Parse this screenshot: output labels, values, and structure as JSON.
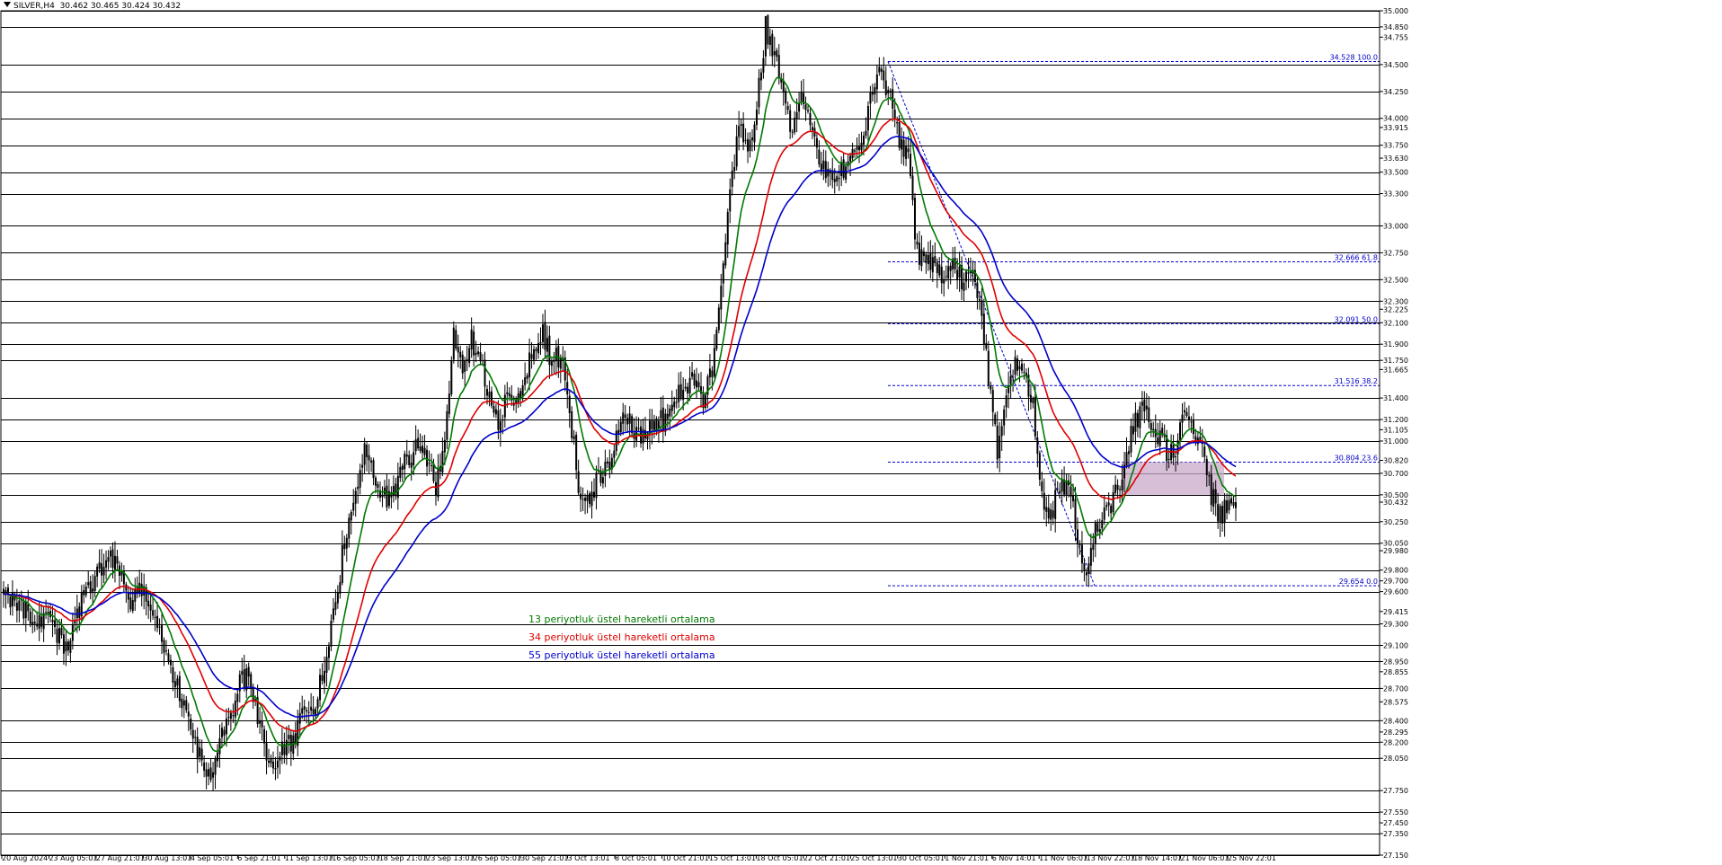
{
  "header": {
    "symbol": "SILVER,H4",
    "ohlc": "30.462 30.465 30.424 30.432"
  },
  "colors": {
    "ema13": "#007a00",
    "ema34": "#e00000",
    "ema55": "#0000cc",
    "fib": "#0000cc",
    "zone": "#c9aac9",
    "candle": "#000000"
  },
  "legend": [
    {
      "label": "13 periyotluk üstel hareketli ortalama",
      "color": "#007a00"
    },
    {
      "label": "34 periyotluk üstel hareketli ortalama",
      "color": "#e00000"
    },
    {
      "label": "55 periyotluk üstel hareketli ortalama",
      "color": "#0000cc"
    }
  ],
  "chart_data": {
    "type": "candlestick",
    "symbol": "SILVER",
    "timeframe": "H4",
    "y_range": [
      27.15,
      35.0
    ],
    "x_ticks": [
      "20 Aug 2024",
      "23 Aug 05:01",
      "27 Aug 21:01",
      "30 Aug 13:01",
      "4 Sep 05:01",
      "6 Sep 21:01",
      "11 Sep 13:01",
      "16 Sep 05:01",
      "18 Sep 21:01",
      "23 Sep 13:01",
      "26 Sep 05:01",
      "30 Sep 21:01",
      "3 Oct 13:01",
      "8 Oct 05:01",
      "10 Oct 21:01",
      "15 Oct 13:01",
      "18 Oct 05:01",
      "22 Oct 21:01",
      "25 Oct 13:01",
      "30 Oct 05:01",
      "1 Nov 21:01",
      "6 Nov 14:01",
      "11 Nov 06:01",
      "13 Nov 22:01",
      "18 Nov 14:01",
      "21 Nov 06:01",
      "25 Nov 22:01"
    ],
    "y_ticks": [
      "35.000",
      "34.850",
      "34.755",
      "34.500",
      "34.250",
      "34.000",
      "33.915",
      "33.750",
      "33.630",
      "33.500",
      "33.300",
      "33.000",
      "32.750",
      "32.500",
      "32.300",
      "32.225",
      "32.100",
      "31.900",
      "31.750",
      "31.665",
      "31.400",
      "31.200",
      "31.105",
      "31.000",
      "30.820",
      "30.700",
      "30.500",
      "30.432",
      "30.250",
      "30.050",
      "29.980",
      "29.800",
      "29.700",
      "29.600",
      "29.415",
      "29.300",
      "29.100",
      "28.950",
      "28.855",
      "28.700",
      "28.575",
      "28.400",
      "28.295",
      "28.200",
      "28.050",
      "27.750",
      "27.550",
      "27.450",
      "27.350",
      "27.150"
    ],
    "horizontal_levels": [
      35.0,
      34.85,
      34.5,
      34.25,
      34.0,
      33.75,
      33.5,
      33.3,
      33.0,
      32.75,
      32.5,
      32.3,
      32.1,
      31.9,
      31.75,
      31.4,
      31.2,
      31.0,
      30.7,
      30.5,
      30.25,
      30.05,
      29.8,
      29.6,
      29.3,
      29.1,
      28.95,
      28.7,
      28.4,
      28.2,
      28.05,
      27.75,
      27.55,
      27.35,
      27.15
    ],
    "current_price": 30.432,
    "fibonacci": {
      "high": 34.528,
      "low": 29.654,
      "levels": [
        {
          "price": 34.528,
          "label": "34.528 100.0"
        },
        {
          "price": 32.666,
          "label": "32.666 61.8"
        },
        {
          "price": 32.091,
          "label": "32.091 50.0"
        },
        {
          "price": 31.516,
          "label": "31.516 38.2"
        },
        {
          "price": 30.804,
          "label": "30.804 23.6"
        },
        {
          "price": 29.654,
          "label": "29.654 0.0"
        }
      ]
    },
    "zone": {
      "top": 30.804,
      "bottom": 30.5
    },
    "anchors": [
      [
        0,
        29.55
      ],
      [
        10,
        29.4
      ],
      [
        20,
        29.35
      ],
      [
        28,
        29.05
      ],
      [
        36,
        29.55
      ],
      [
        44,
        29.85
      ],
      [
        50,
        29.9
      ],
      [
        56,
        29.5
      ],
      [
        62,
        29.6
      ],
      [
        68,
        29.4
      ],
      [
        74,
        28.95
      ],
      [
        80,
        28.6
      ],
      [
        86,
        28.2
      ],
      [
        92,
        27.9
      ],
      [
        96,
        28.1
      ],
      [
        100,
        28.35
      ],
      [
        106,
        28.75
      ],
      [
        110,
        28.85
      ],
      [
        114,
        28.45
      ],
      [
        118,
        28.1
      ],
      [
        122,
        27.95
      ],
      [
        126,
        28.15
      ],
      [
        130,
        28.2
      ],
      [
        134,
        28.45
      ],
      [
        140,
        28.55
      ],
      [
        146,
        29.15
      ],
      [
        150,
        29.65
      ],
      [
        154,
        30.2
      ],
      [
        158,
        30.6
      ],
      [
        162,
        30.9
      ],
      [
        166,
        30.75
      ],
      [
        170,
        30.5
      ],
      [
        174,
        30.45
      ],
      [
        180,
        30.85
      ],
      [
        186,
        30.95
      ],
      [
        190,
        30.8
      ],
      [
        194,
        30.6
      ],
      [
        198,
        31.0
      ],
      [
        202,
        32.0
      ],
      [
        206,
        31.7
      ],
      [
        210,
        31.95
      ],
      [
        214,
        31.75
      ],
      [
        218,
        31.45
      ],
      [
        222,
        31.2
      ],
      [
        226,
        31.4
      ],
      [
        230,
        31.4
      ],
      [
        234,
        31.6
      ],
      [
        238,
        31.85
      ],
      [
        242,
        32.0
      ],
      [
        246,
        31.75
      ],
      [
        250,
        31.8
      ],
      [
        254,
        31.3
      ],
      [
        258,
        30.6
      ],
      [
        262,
        30.45
      ],
      [
        266,
        30.6
      ],
      [
        270,
        30.7
      ],
      [
        274,
        30.95
      ],
      [
        278,
        31.2
      ],
      [
        282,
        31.15
      ],
      [
        286,
        31.0
      ],
      [
        290,
        31.1
      ],
      [
        294,
        31.2
      ],
      [
        298,
        31.15
      ],
      [
        302,
        31.4
      ],
      [
        306,
        31.5
      ],
      [
        310,
        31.6
      ],
      [
        314,
        31.4
      ],
      [
        318,
        31.7
      ],
      [
        322,
        32.45
      ],
      [
        326,
        33.35
      ],
      [
        330,
        33.95
      ],
      [
        334,
        33.65
      ],
      [
        338,
        34.1
      ],
      [
        342,
        34.85
      ],
      [
        346,
        34.6
      ],
      [
        350,
        34.3
      ],
      [
        354,
        33.8
      ],
      [
        358,
        34.25
      ],
      [
        362,
        33.9
      ],
      [
        366,
        33.55
      ],
      [
        370,
        33.5
      ],
      [
        374,
        33.4
      ],
      [
        378,
        33.6
      ],
      [
        382,
        33.7
      ],
      [
        386,
        33.8
      ],
      [
        390,
        34.3
      ],
      [
        394,
        34.45
      ],
      [
        398,
        34.15
      ],
      [
        402,
        33.75
      ],
      [
        406,
        33.6
      ],
      [
        410,
        32.75
      ],
      [
        414,
        32.6
      ],
      [
        418,
        32.7
      ],
      [
        422,
        32.4
      ],
      [
        426,
        32.65
      ],
      [
        430,
        32.5
      ],
      [
        434,
        32.55
      ],
      [
        438,
        32.3
      ],
      [
        442,
        31.6
      ],
      [
        446,
        30.9
      ],
      [
        450,
        31.4
      ],
      [
        454,
        31.8
      ],
      [
        458,
        31.6
      ],
      [
        462,
        31.35
      ],
      [
        466,
        30.5
      ],
      [
        470,
        30.3
      ],
      [
        474,
        30.6
      ],
      [
        478,
        30.6
      ],
      [
        482,
        30.1
      ],
      [
        486,
        29.7
      ],
      [
        490,
        30.2
      ],
      [
        494,
        30.3
      ],
      [
        498,
        30.45
      ],
      [
        502,
        30.6
      ],
      [
        506,
        31.05
      ],
      [
        510,
        31.3
      ],
      [
        514,
        31.2
      ],
      [
        518,
        31.05
      ],
      [
        522,
        30.9
      ],
      [
        526,
        30.95
      ],
      [
        530,
        31.2
      ],
      [
        534,
        31.15
      ],
      [
        538,
        30.9
      ],
      [
        542,
        30.5
      ],
      [
        546,
        30.3
      ],
      [
        550,
        30.4
      ],
      [
        553,
        30.432
      ]
    ]
  }
}
